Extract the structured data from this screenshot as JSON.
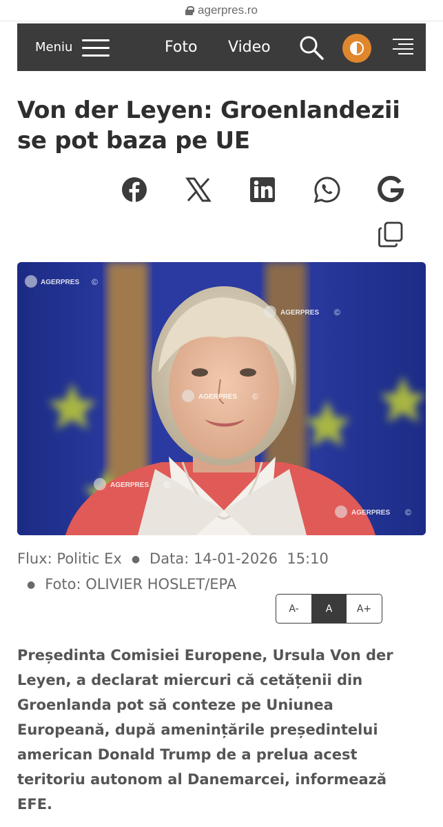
{
  "browser": {
    "url": "agerpres.ro"
  },
  "nav": {
    "menu_label": "Meniu",
    "foto_label": "Foto",
    "video_label": "Video",
    "theme_color": "#e0872e",
    "bar_color": "#3b3b3b"
  },
  "article": {
    "title": "Von der Leyen: Groenlandezii se pot baza pe UE",
    "share_icons": [
      "facebook-icon",
      "x-icon",
      "linkedin-icon",
      "whatsapp-icon",
      "google-icon",
      "copy-icon"
    ],
    "image": {
      "watermark": "AGERPRES",
      "watermark_symbol": "©"
    },
    "meta": {
      "flux": "Flux: Politic Ex",
      "date": "Data: 14-01-2026  15:10",
      "photo": "Foto: OLIVIER HOSLET/EPA"
    },
    "font_size": {
      "decrease": "A-",
      "normal": "A",
      "increase": "A+",
      "selected": "A"
    },
    "lead": "Președinta Comisiei Europene, Ursula Von der Leyen, a declarat miercuri că cetățenii din Groenlanda pot să conteze pe Uniunea Europeană, după amenințările președintelui american Donald Trump de a prelua acest teritoriu autonom al Danemarcei, informează EFE."
  }
}
